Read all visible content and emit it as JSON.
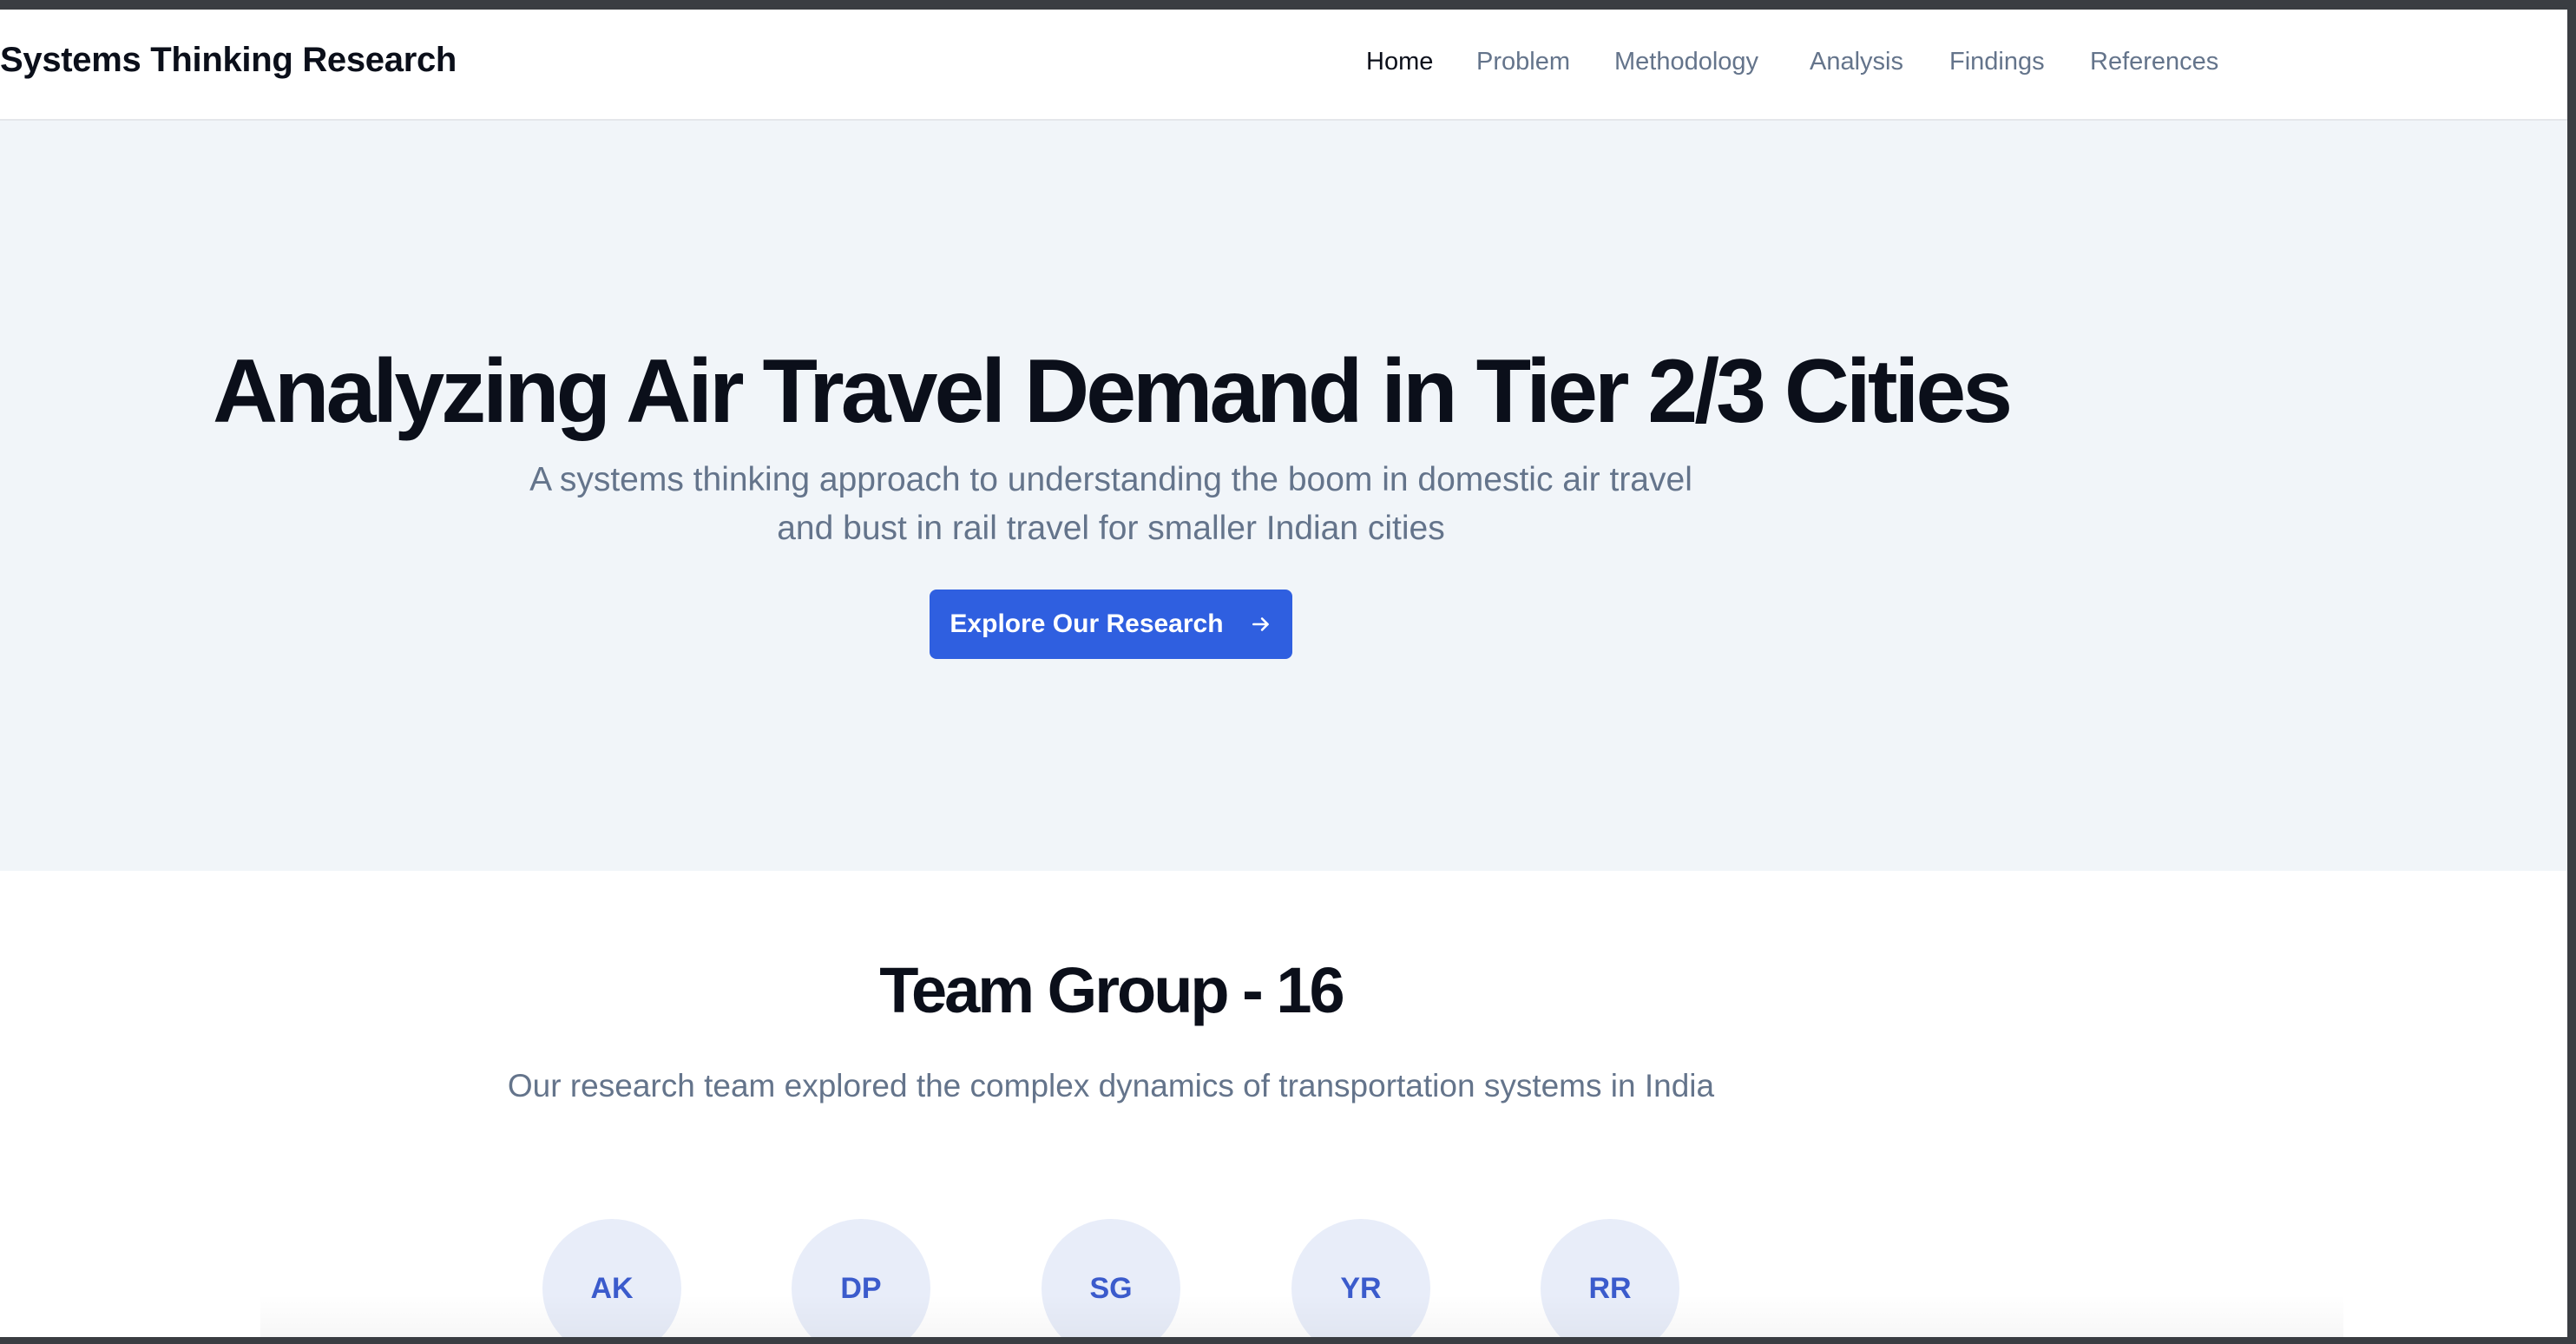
{
  "header": {
    "brand": "Systems Thinking Research",
    "nav": [
      {
        "label": "Home",
        "active": true
      },
      {
        "label": "Problem",
        "active": false
      },
      {
        "label": "Methodology",
        "active": false
      },
      {
        "label": "Analysis",
        "active": false
      },
      {
        "label": "Findings",
        "active": false
      },
      {
        "label": "References",
        "active": false
      }
    ]
  },
  "hero": {
    "title": "Analyzing Air Travel Demand in Tier 2/3 Cities",
    "subtitle": "A systems thinking approach to understanding the boom in domestic air travel and bust in rail travel for smaller Indian cities",
    "cta_label": "Explore Our Research",
    "cta_icon": "arrow-right-icon"
  },
  "team": {
    "title": "Team Group - 16",
    "subtitle": "Our research team explored the complex dynamics of transportation systems in India",
    "members": [
      "AK",
      "DP",
      "SG",
      "YR",
      "RR"
    ]
  },
  "colors": {
    "accent": "#2f5fe0",
    "hero_bg": "#f1f5f9",
    "avatar_bg": "#e8edf9",
    "avatar_text": "#3b5bcc",
    "muted_text": "#64748b"
  }
}
